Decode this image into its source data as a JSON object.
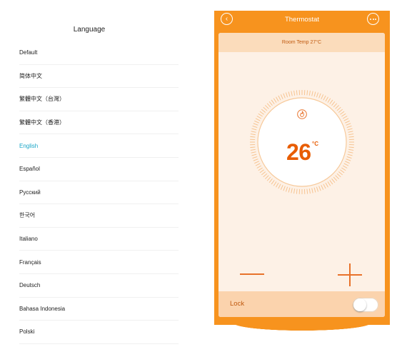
{
  "language": {
    "title": "Language",
    "selected": "English",
    "items": [
      {
        "label": "Default"
      },
      {
        "label": "简体中文"
      },
      {
        "label": "繁體中文（台灣）"
      },
      {
        "label": "繁體中文（香港）"
      },
      {
        "label": "English"
      },
      {
        "label": "Español"
      },
      {
        "label": "Русский"
      },
      {
        "label": "한국어"
      },
      {
        "label": "Italiano"
      },
      {
        "label": "Français"
      },
      {
        "label": "Deutsch"
      },
      {
        "label": "Bahasa Indonesia"
      },
      {
        "label": "Polski"
      }
    ]
  },
  "thermostat": {
    "title": "Thermostat",
    "back_icon": "chevron-left-icon",
    "more_icon": "more-dots-icon",
    "room_temp": "Room Temp 27°C",
    "set_temp": "26",
    "unit": "°C",
    "mode_icon": "flame-icon",
    "lock_label": "Lock",
    "lock_on": false
  },
  "colors": {
    "accent": "#f7931e",
    "temp_text": "#e85d04",
    "selected_language": "#1aa6c7",
    "card_bg": "#fdf1e6",
    "room_bar": "#fbdcbb",
    "lock_bar": "#fbd3ad"
  }
}
